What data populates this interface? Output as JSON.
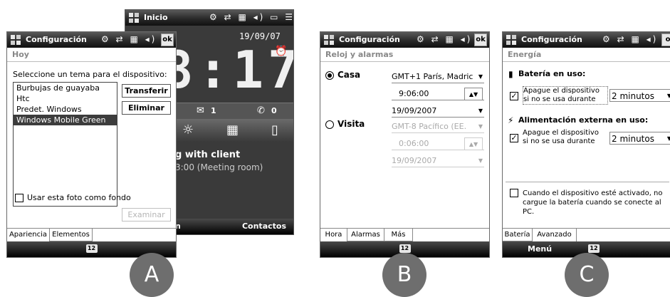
{
  "phone_a": {
    "title": "Configuración",
    "ok": "ok",
    "section": "Hoy",
    "prompt": "Seleccione un tema para el dispositivo:",
    "themes": [
      "Burbujas de guayaba",
      "Htc",
      "Predet. Windows",
      "Windows Mobile Green"
    ],
    "selected_theme": "Windows Mobile Green",
    "transfer_label": "Transferir",
    "delete_label": "Eliminar",
    "photo_checkbox_label": "Usar esta foto como fondo",
    "browse_label": "Examinar",
    "tabs": [
      "Apariencia",
      "Elementos"
    ],
    "kbd": "12"
  },
  "today_screen": {
    "title": "Inicio",
    "date": "19/09/07",
    "clock": "8:17",
    "messages_count": "1",
    "calls_count": "0",
    "appointment_title": "g with client",
    "appointment_detail": "3:00 (Meeting room)",
    "softkey_left": "n",
    "softkey_right": "Contactos"
  },
  "phone_b": {
    "title": "Configuración",
    "ok": "ok",
    "section": "Reloj y alarmas",
    "home_label": "Casa",
    "home_zone": "GMT+1 París, Madric",
    "home_time": "9:06:00",
    "home_date": "19/09/2007",
    "visit_label": "Visita",
    "visit_zone": "GMT-8 Pacífico (EE.",
    "visit_time": "0:06:00",
    "visit_date": "19/09/2007",
    "tabs": [
      "Hora",
      "Alarmas",
      "Más"
    ],
    "kbd": "12"
  },
  "phone_c": {
    "title": "Configuración",
    "section": "Energía",
    "battery_heading": "Batería en uso:",
    "battery_text": "Apague el dispositivo si no se usa durante",
    "battery_value": "2 minutos",
    "external_heading": "Alimentación externa en uso:",
    "external_text": "Apague el dispositivo si no se usa durante",
    "external_value": "2 minutos",
    "charge_text": "Cuando el dispositivo esté activado, no cargue la batería cuando se conecte al PC.",
    "tabs": [
      "Batería",
      "Avanzado"
    ],
    "softkey": "Menú",
    "kbd": "12"
  },
  "labels": {
    "a": "A",
    "b": "B",
    "c": "C"
  },
  "colors": {
    "selection": "#3c3c3c",
    "titlebar": "#1e1e1e",
    "label_circle": "#6e6e6e"
  }
}
